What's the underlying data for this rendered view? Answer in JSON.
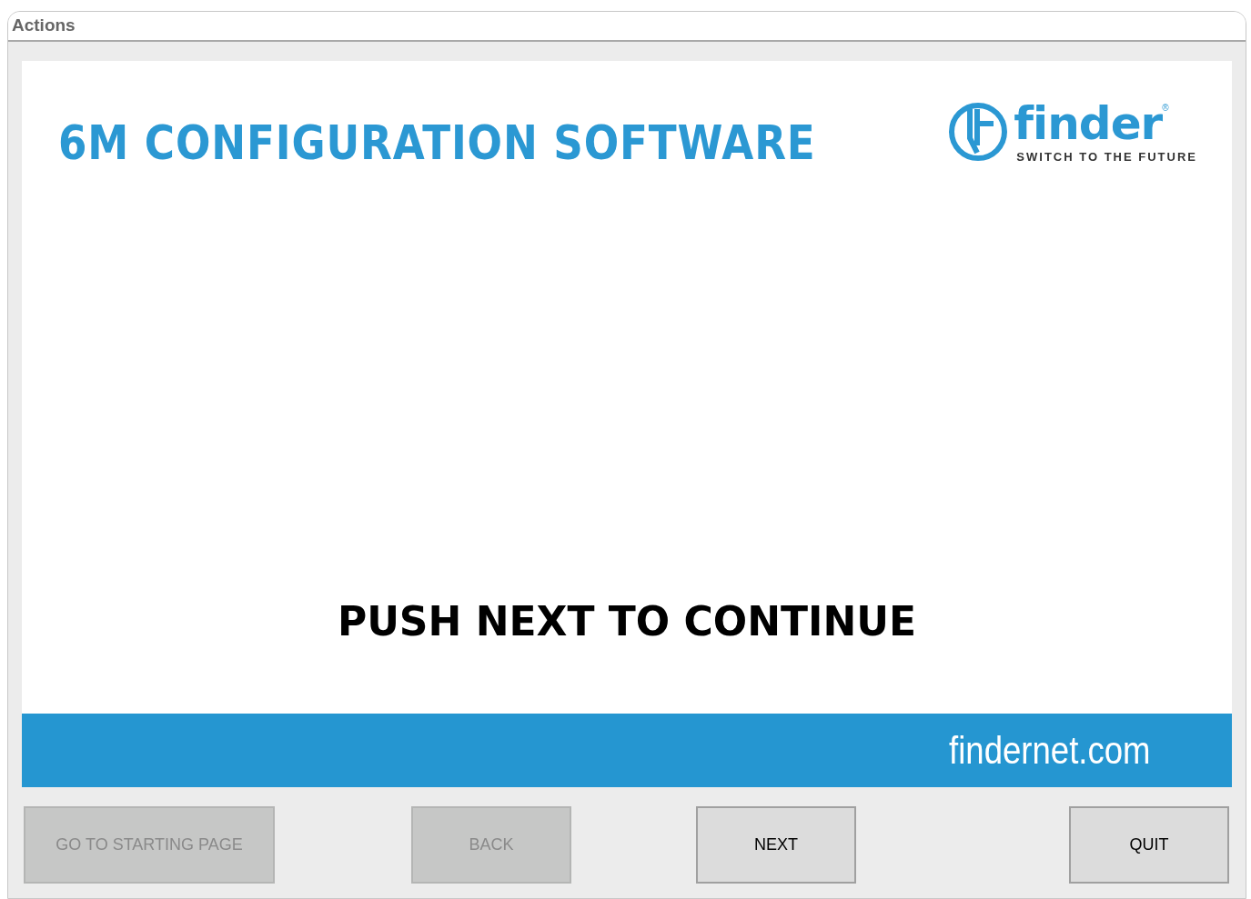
{
  "window": {
    "title": "Actions"
  },
  "header": {
    "title": "6M CONFIGURATION SOFTWARE",
    "logo": {
      "wordmark": "finder",
      "registered": "®",
      "tagline": "SWITCH TO THE FUTURE"
    }
  },
  "message": "PUSH NEXT TO CONTINUE",
  "footer_band": {
    "website": "findernet.com"
  },
  "buttons": [
    {
      "label": "GO TO STARTING PAGE",
      "disabled": true
    },
    {
      "label": "BACK",
      "disabled": true
    },
    {
      "label": "NEXT",
      "disabled": false
    },
    {
      "label": "QUIT",
      "disabled": false
    }
  ]
}
